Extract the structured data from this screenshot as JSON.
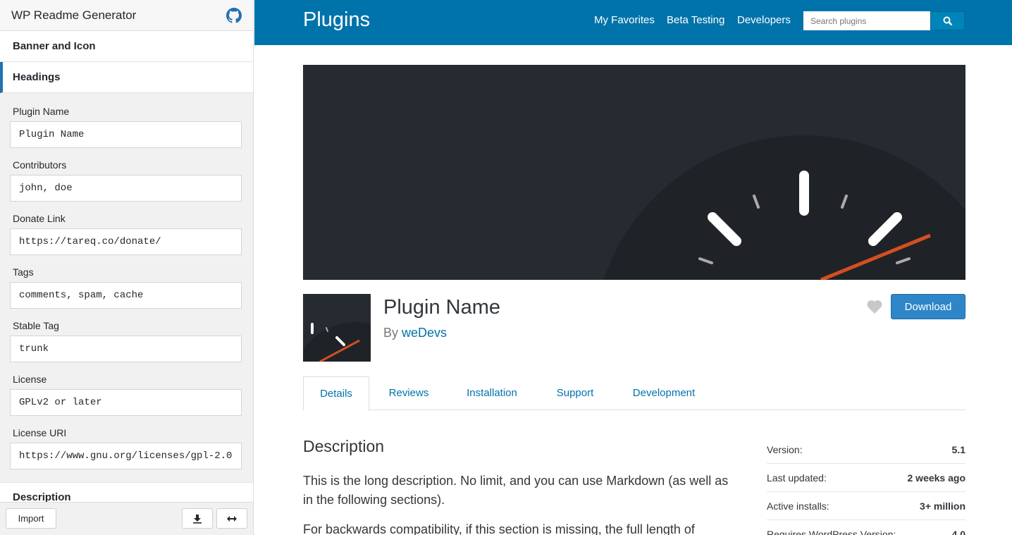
{
  "app": {
    "title": "WP Readme Generator",
    "github_icon": "github-icon"
  },
  "sections": [
    {
      "label": "Banner and Icon",
      "active": false
    },
    {
      "label": "Headings",
      "active": true
    }
  ],
  "fields": [
    {
      "label": "Plugin Name",
      "value": "Plugin Name"
    },
    {
      "label": "Contributors",
      "value": "john, doe"
    },
    {
      "label": "Donate Link",
      "value": "https://tareq.co/donate/"
    },
    {
      "label": "Tags",
      "value": "comments, spam, cache"
    },
    {
      "label": "Stable Tag",
      "value": "trunk"
    },
    {
      "label": "License",
      "value": "GPLv2 or later"
    },
    {
      "label": "License URI",
      "value": "https://www.gnu.org/licenses/gpl-2.0"
    }
  ],
  "next_section": {
    "label": "Description"
  },
  "footer": {
    "import_label": "Import",
    "download_icon": "download-icon",
    "expand_icon": "expand-icon"
  },
  "wp": {
    "header_title": "Plugins",
    "nav": [
      "My Favorites",
      "Beta Testing",
      "Developers"
    ],
    "search_placeholder": "Search plugins",
    "plugin_name": "Plugin Name",
    "by_label": "By",
    "author": "weDevs",
    "download_label": "Download",
    "tabs": [
      "Details",
      "Reviews",
      "Installation",
      "Support",
      "Development"
    ],
    "active_tab": "Details",
    "description_heading": "Description",
    "description_p1": "This is the long description. No limit, and you can use Markdown (as well as in the following sections).",
    "description_p2": "For backwards compatibility, if this section is missing, the full length of",
    "meta": [
      {
        "key": "Version:",
        "value": "5.1"
      },
      {
        "key": "Last updated:",
        "value": "2 weeks ago"
      },
      {
        "key": "Active installs:",
        "value": "3+ million"
      },
      {
        "key": "Requires WordPress Version:",
        "value": "4.0"
      }
    ],
    "colors": {
      "header": "#0073aa",
      "download": "#2e86c8",
      "banner_bg": "#262b31",
      "needle": "#d54e21"
    }
  }
}
